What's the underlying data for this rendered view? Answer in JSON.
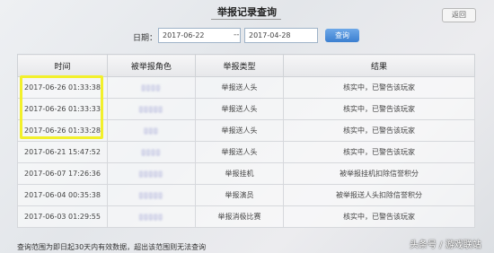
{
  "page": {
    "title": "举报记录查询",
    "back_label": "返回"
  },
  "filter": {
    "date_label": "日期：",
    "start_date": "2017-06-22",
    "separator": "--",
    "end_date": "2017-04-28",
    "query_label": "查询"
  },
  "table": {
    "headers": [
      "时间",
      "被举报角色",
      "举报类型",
      "结果"
    ],
    "rows": [
      {
        "time": "2017-06-26 01:33:38",
        "role": "▯▯▯▯",
        "type": "举报送人头",
        "result": "核实中，已警告该玩家"
      },
      {
        "time": "2017-06-26 01:33:33",
        "role": "▯▯▯▯▯",
        "type": "举报送人头",
        "result": "核实中，已警告该玩家"
      },
      {
        "time": "2017-06-26 01:33:28",
        "role": "▯▯▯",
        "type": "举报送人头",
        "result": "核实中，已警告该玩家"
      },
      {
        "time": "2017-06-21 15:47:52",
        "role": "▯▯▯▯",
        "type": "举报送人头",
        "result": "核实中，已警告该玩家"
      },
      {
        "time": "2017-06-07 17:26:36",
        "role": "▯▯▯▯▯",
        "type": "举报挂机",
        "result": "被举报挂机扣除信誉积分"
      },
      {
        "time": "2017-06-04 00:35:38",
        "role": "▯▯▯▯▯",
        "type": "举报演员",
        "result": "被举报送人头扣除信誉积分"
      },
      {
        "time": "2017-06-03 01:29:55",
        "role": "▯▯▯▯▯",
        "type": "举报消极比赛",
        "result": "核实中，已警告该玩家"
      }
    ]
  },
  "footer": {
    "note": "查询范围为即日起30天内有效数据，超出该范围则无法查询"
  },
  "watermark": {
    "text": "头条号 / 游戏联站"
  },
  "colors": {
    "highlight": "#f2f02b",
    "accent": "#3b7fd0"
  }
}
